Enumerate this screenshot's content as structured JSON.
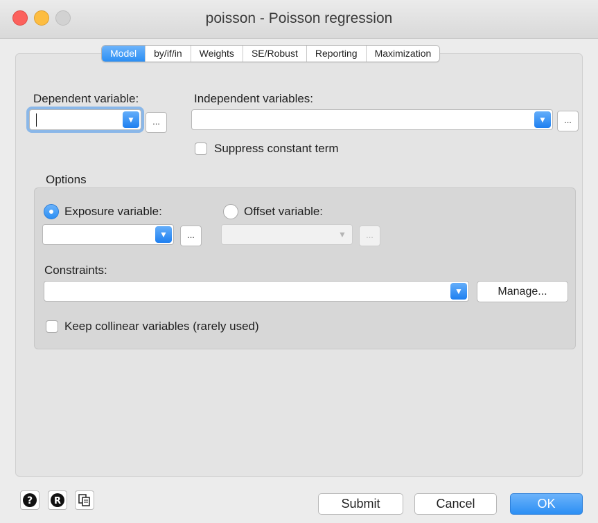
{
  "window": {
    "title": "poisson - Poisson regression"
  },
  "tabs": [
    {
      "label": "Model"
    },
    {
      "label": "by/if/in"
    },
    {
      "label": "Weights"
    },
    {
      "label": "SE/Robust"
    },
    {
      "label": "Reporting"
    },
    {
      "label": "Maximization"
    }
  ],
  "model": {
    "dependent_label": "Dependent variable:",
    "independent_label": "Independent variables:",
    "browse_label": "...",
    "suppress_constant_label": "Suppress constant term"
  },
  "options": {
    "group_label": "Options",
    "exposure_label": "Exposure variable:",
    "offset_label": "Offset variable:",
    "constraints_label": "Constraints:",
    "manage_label": "Manage...",
    "collinear_label": "Keep collinear variables (rarely used)"
  },
  "footer": {
    "submit_label": "Submit",
    "cancel_label": "Cancel",
    "ok_label": "OK"
  },
  "icons": {
    "dropdown": "chevron-down-icon",
    "help": "help-icon",
    "reset": "reset-icon",
    "copy": "copy-command-icon"
  },
  "colors": {
    "accent": "#2c8ff4",
    "close": "#fc615d",
    "minimize": "#fdbd41"
  }
}
